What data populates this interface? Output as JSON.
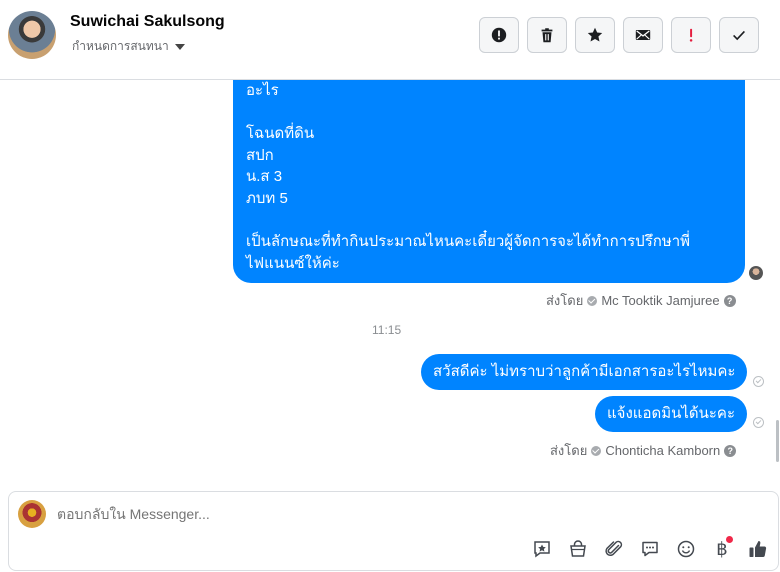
{
  "header": {
    "contact_name": "Suwichai Sakulsong",
    "assign_label": "กำหนดการสนทนา",
    "actions": [
      {
        "icon": "alert-circle-icon"
      },
      {
        "icon": "trash-icon"
      },
      {
        "icon": "star-icon"
      },
      {
        "icon": "envelope-icon"
      },
      {
        "icon": "exclamation-icon",
        "color": "#e41e3f"
      },
      {
        "icon": "checkmark-icon"
      }
    ]
  },
  "conversation": {
    "big_message_lines": [
      "อะไร",
      "",
      "โฉนดที่ดิน",
      "สปก",
      "น.ส 3",
      "ภบท 5",
      "",
      "เป็นลักษณะที่ทำกินประมาณไหนคะเดี๋ยวผู้จัดการจะได้ทำการปรึกษาพี่",
      "ไฟแนนซ์ให้ค่ะ"
    ],
    "sent_by_label_1": "ส่งโดย",
    "sender_1": "Mc Tooktik Jamjuree",
    "timestamp": "11:15",
    "message_2": "สวัสดีค่ะ ไม่ทราบว่าลูกค้ามีเอกสารอะไรไหมคะ",
    "message_3": "แจ้งแอดมินได้นะคะ",
    "sent_by_label_2": "ส่งโดย",
    "sender_2": "Chonticha Kamborn",
    "bubble_color": "#0084ff"
  },
  "composer": {
    "placeholder": "ตอบกลับใน Messenger...",
    "tools": [
      "saved-reply-icon",
      "shopping-bag-icon",
      "paperclip-icon",
      "chat-bubble-icon",
      "emoji-icon",
      "baht-icon",
      "thumbs-up-icon"
    ],
    "baht_symbol": "฿"
  }
}
